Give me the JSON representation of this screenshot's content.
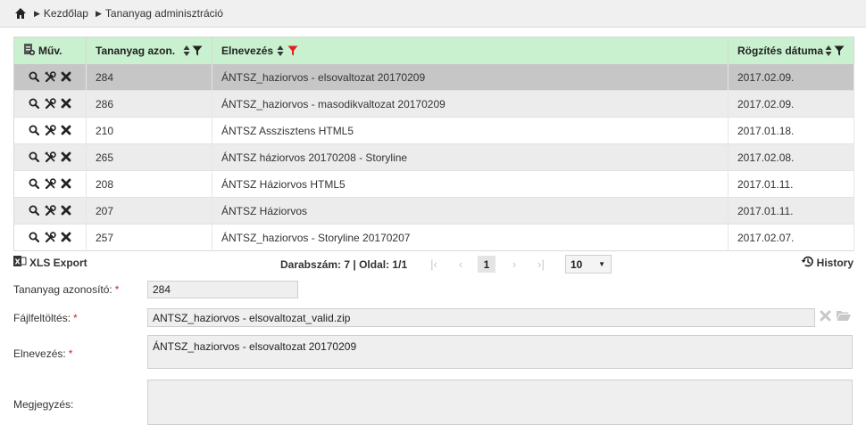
{
  "breadcrumb": {
    "home_icon": "home-icon",
    "items": [
      "Kezdőlap",
      "Tananyag adminisztráció"
    ]
  },
  "table": {
    "columns": {
      "actions": "Műv.",
      "id": "Tananyag azon.",
      "name": "Elnevezés",
      "date": "Rögzítés dátuma"
    },
    "header_bg": "#c9f0cf",
    "active_filter_color": "#e02020",
    "rows": [
      {
        "id": "284",
        "name": "ÁNTSZ_haziorvos - elsovaltozat 20170209",
        "date": "2017.02.09."
      },
      {
        "id": "286",
        "name": "ÁNTSZ_haziorvos - masodikvaltozat 20170209",
        "date": "2017.02.09."
      },
      {
        "id": "210",
        "name": "ÁNTSZ Asszisztens HTML5",
        "date": "2017.01.18."
      },
      {
        "id": "265",
        "name": "ÁNTSZ háziorvos 20170208 - Storyline",
        "date": "2017.02.08."
      },
      {
        "id": "208",
        "name": "ÁNTSZ Háziorvos HTML5",
        "date": "2017.01.11."
      },
      {
        "id": "207",
        "name": "ÁNTSZ Háziorvos",
        "date": "2017.01.11."
      },
      {
        "id": "257",
        "name": "ÁNTSZ_haziorvos - Storyline 20170207",
        "date": "2017.02.07."
      }
    ]
  },
  "toolbar": {
    "xls_export": "XLS Export",
    "count_label": "Darabszám: 7",
    "page_label": "Oldal: 1/1",
    "separator": "|",
    "current_page": "1",
    "page_size": "10",
    "history": "History"
  },
  "form": {
    "id_label": "Tananyag azonosító:",
    "id_value": "284",
    "file_label": "Fájlfeltöltés:",
    "file_value": "ANTSZ_haziorvos - elsovaltozat_valid.zip",
    "name_label": "Elnevezés:",
    "name_value": "ÁNTSZ_haziorvos - elsovaltozat 20170209",
    "note_label": "Megjegyzés:",
    "note_value": "",
    "required_mark": "*"
  }
}
